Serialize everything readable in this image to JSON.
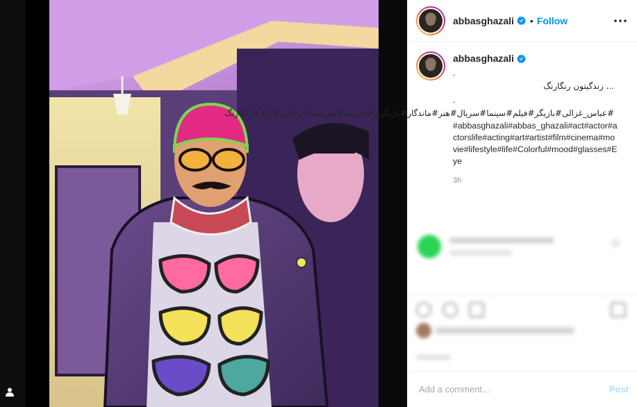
{
  "post": {
    "username": "abbasghazali",
    "follow_label": "Follow",
    "separator": "•",
    "verified_icon": "verified-badge-icon",
    "more_icon": "more-options-icon"
  },
  "caption": {
    "username": "abbasghazali",
    "dot_line_1": ".",
    "persian_line": "... زندگیتون رنگارنگ",
    "dot_line_2": ".",
    "persian_tags": "#عباس_غزالی#بازیگر#فیلم#سینما#سریال#هنر#ماندگار#بازیگری#هنرمند#هنرپیشه#زندگی#رنگ#رنگارنگ",
    "english_tags": "#abbasghazali#abbas_ghazali#act#actor#actorslife#acting#art#artist#film#cinema#movie#lifestyle#life#Colorful#mood#glasses#Eye",
    "timestamp": "3h"
  },
  "comment_box": {
    "placeholder": "Add a comment...",
    "post_label": "Post"
  },
  "icons": {
    "user_tag": "user-tag-icon"
  },
  "colors": {
    "accent": "#0095f6",
    "post_disabled": "#b3dbff",
    "muted": "#8e8e8e",
    "ring_start": "#feda75",
    "ring_end": "#962fbf"
  }
}
